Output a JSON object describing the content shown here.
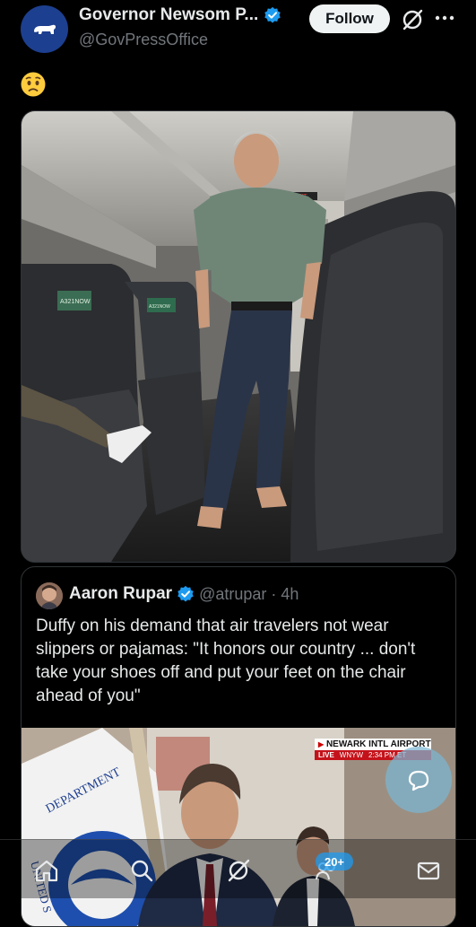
{
  "post": {
    "author_name": "Governor Newsom P...",
    "author_handle": "@GovPressOffice",
    "follow_label": "Follow",
    "text": "😟"
  },
  "quote": {
    "author_name": "Aaron Rupar",
    "author_handle": "@atrupar",
    "separator": "·",
    "time": "4h",
    "text": "Duffy on his demand that air travelers not wear slippers or pajamas: \"It honors our country ... don't take your shoes off and put your feet on the chair ahead of you\""
  },
  "media": {
    "cabin_exit_sign": "EXIT",
    "seat_screen_label": "A321NOW",
    "seat_screen_label_2": "A321NOW",
    "flag_text": "DEPARTMENT",
    "flag_text_2": "UNITED S"
  },
  "news_chyron": {
    "location": "NEWARK INTL AIRPORT",
    "live": "LIVE",
    "channel": "WNYW",
    "time": "2:34 PM ET"
  },
  "bottom_nav": {
    "notification_count": "20+"
  },
  "colors": {
    "background": "#000000",
    "text_primary": "#e7e9ea",
    "text_secondary": "#71767b",
    "verified_blue": "#1d9bf0",
    "border": "#2f3336"
  },
  "icons": [
    "ca-bear-logo-icon",
    "verified-badge-icon",
    "grok-icon",
    "more-icon",
    "worried-face-emoji",
    "home-icon",
    "search-icon",
    "grok-nav-icon",
    "communities-icon",
    "messages-icon",
    "compose-icon"
  ]
}
